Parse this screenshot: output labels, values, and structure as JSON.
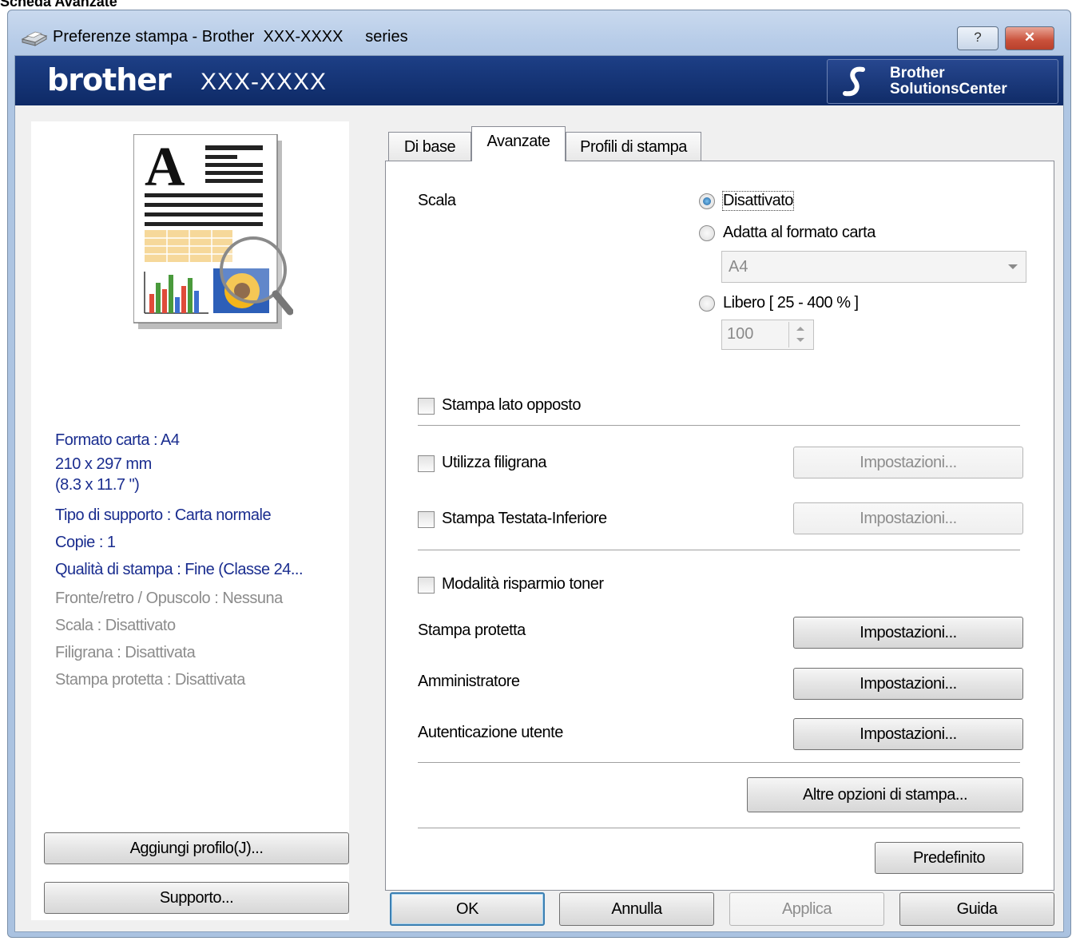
{
  "caption": "Scheda Avanzate",
  "window": {
    "title": "Preferenze stampa - Brother  XXX-XXXX     series",
    "help_label": "?",
    "close_label": "✕"
  },
  "banner": {
    "logo": "brother",
    "model": "XXX-XXXX",
    "solutions_line1": "Brother",
    "solutions_line2": "SolutionsCenter"
  },
  "summary": {
    "paper_size": "Formato carta : A4",
    "dimensions_mm": "210 x 297 mm",
    "dimensions_in": "(8.3 x 11.7 \")",
    "media_type": "Tipo di supporto : Carta normale",
    "copies": "Copie : 1",
    "quality": "Qualità di stampa : Fine (Classe 24...",
    "duplex": "Fronte/retro / Opuscolo : Nessuna",
    "scale": "Scala : Disattivato",
    "watermark": "Filigrana : Disattivata",
    "secure": "Stampa protetta : Disattivata"
  },
  "left_buttons": {
    "add_profile": "Aggiungi profilo(J)...",
    "support": "Supporto..."
  },
  "tabs": [
    {
      "label": "Di base"
    },
    {
      "label": "Avanzate"
    },
    {
      "label": "Profili di stampa"
    }
  ],
  "advanced": {
    "scale_label": "Scala",
    "scale_off": "Disattivato",
    "fit_paper": "Adatta al formato carta",
    "paper_select": "A4",
    "free_scale": "Libero [ 25 - 400 % ]",
    "free_value": "100",
    "reverse_print": "Stampa lato opposto",
    "use_watermark": "Utilizza filigrana",
    "header_footer": "Stampa Testata-Inferiore",
    "toner_save": "Modalità risparmio toner",
    "secure_print": "Stampa protetta",
    "administrator": "Amministratore",
    "user_auth": "Autenticazione utente",
    "settings": "Impostazioni...",
    "other_options": "Altre opzioni di stampa...",
    "default": "Predefinito"
  },
  "footer": {
    "ok": "OK",
    "cancel": "Annulla",
    "apply": "Applica",
    "help": "Guida"
  }
}
